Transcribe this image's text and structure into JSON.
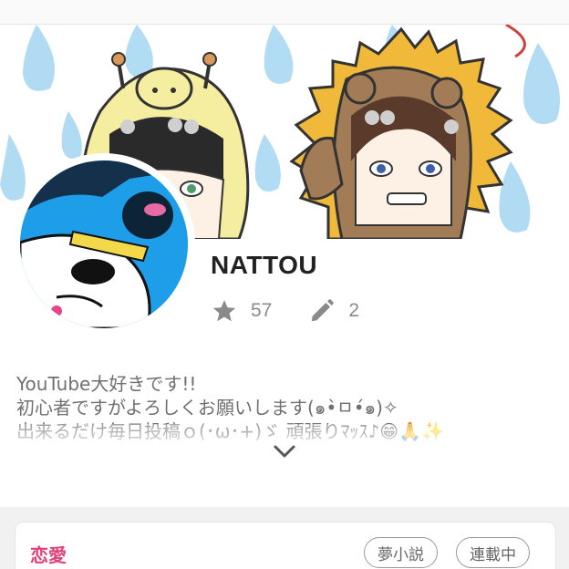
{
  "profile": {
    "username": "NATTOU",
    "stars": "57",
    "works": "2"
  },
  "icons": {
    "star": "star-icon",
    "pencil": "pencil-icon",
    "expand": "chevron-down-icon"
  },
  "bio": {
    "lines": [
      "YouTube大好きです!!",
      "初心者ですがよろしくお願いします(๑•̀ㅁ•́๑)✧",
      "出来るだけ毎日投稿ｏ(･ω･+)ゞ 頑張りﾏｯｽ♪😁🙏✨"
    ]
  },
  "work_card": {
    "category": "恋愛",
    "tags": [
      "夢小説",
      "連載中"
    ]
  },
  "colors": {
    "accent_category": "#e0407a",
    "stat_gray": "#8a8a8a",
    "avatar_blue": "#1e9ee8"
  }
}
